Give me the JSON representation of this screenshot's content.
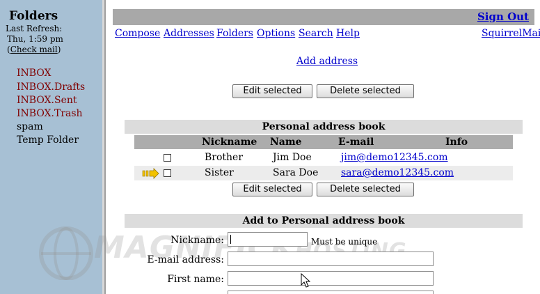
{
  "sidebar": {
    "title": "Folders",
    "last_refresh_label": "Last Refresh:",
    "refresh_time": "Thu, 1:59 pm",
    "check_mail_open": "(",
    "check_mail": "Check mail",
    "check_mail_close": ")",
    "folders": [
      {
        "label": "INBOX"
      },
      {
        "label": "INBOX.Drafts"
      },
      {
        "label": "INBOX.Sent"
      },
      {
        "label": "INBOX.Trash"
      },
      {
        "label": "spam"
      },
      {
        "label": "Temp Folder"
      }
    ]
  },
  "header": {
    "sign_out": "Sign Out",
    "brand": "SquirrelMail",
    "nav": [
      "Compose",
      "Addresses",
      "Folders",
      "Options",
      "Search",
      "Help"
    ]
  },
  "addresses": {
    "add_address": "Add address",
    "edit_selected": "Edit selected",
    "delete_selected": "Delete selected",
    "book_title": "Personal address book",
    "columns": [
      "Nickname",
      "Name",
      "E-mail",
      "Info"
    ],
    "rows": [
      {
        "nickname": "Brother",
        "name": "Jim Doe",
        "email": "jim@demo12345.com"
      },
      {
        "nickname": "Sister",
        "name": "Sara Doe",
        "email": "sara@demo12345.com"
      }
    ]
  },
  "add_form": {
    "title": "Add to Personal address book",
    "nickname_label": "Nickname:",
    "nickname_hint": "Must be unique",
    "email_label": "E-mail address:",
    "firstname_label": "First name:"
  },
  "watermark": {
    "text_big": "MAGNIFICK",
    "text_small": "HOSTING"
  },
  "colors": {
    "sidebar": "#a7c0d4",
    "folder_red": "#800000",
    "link": "#0000cc",
    "topbar": "#a8a8a8"
  }
}
